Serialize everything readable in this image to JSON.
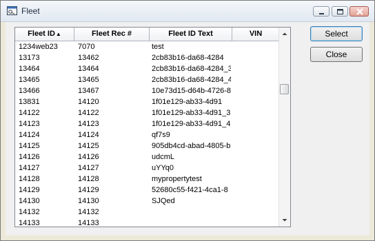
{
  "window": {
    "title": "Fleet"
  },
  "table": {
    "columns": [
      "Fleet ID",
      "Fleet Rec #",
      "Fleet ID Text",
      "VIN"
    ],
    "sort_indicator": "▲",
    "rows": [
      [
        "1234web23",
        "7070",
        "test",
        ""
      ],
      [
        "13173",
        "13462",
        "2cb83b16-da68-4284",
        ""
      ],
      [
        "13464",
        "13464",
        "2cb83b16-da68-4284_3",
        ""
      ],
      [
        "13465",
        "13465",
        "2cb83b16-da68-4284_4",
        ""
      ],
      [
        "13466",
        "13467",
        "10e73d15-d64b-4726-8",
        ""
      ],
      [
        "13831",
        "14120",
        "1f01e129-ab33-4d91",
        ""
      ],
      [
        "14122",
        "14122",
        "1f01e129-ab33-4d91_3",
        ""
      ],
      [
        "14123",
        "14123",
        "1f01e129-ab33-4d91_4",
        ""
      ],
      [
        "14124",
        "14124",
        "qf7s9",
        ""
      ],
      [
        "14125",
        "14125",
        "905db4cd-abad-4805-b",
        ""
      ],
      [
        "14126",
        "14126",
        "udcmL",
        ""
      ],
      [
        "14127",
        "14127",
        "uYYq0",
        ""
      ],
      [
        "14128",
        "14128",
        "mypropertytest",
        ""
      ],
      [
        "14129",
        "14129",
        "52680c55-f421-4ca1-8",
        ""
      ],
      [
        "14130",
        "14130",
        "SJQed",
        ""
      ],
      [
        "14132",
        "14132",
        "",
        ""
      ],
      [
        "14133",
        "14133",
        "",
        ""
      ]
    ]
  },
  "buttons": {
    "select": "Select",
    "close": "Close"
  },
  "icons": {
    "app": "app-window-icon",
    "minimize": "minimize-icon",
    "maximize": "maximize-icon",
    "close": "close-icon",
    "scroll_up": "scroll-up-arrow-icon",
    "scroll_down": "scroll-down-arrow-icon",
    "sort": "sort-ascending-icon"
  },
  "colors": {
    "accent": "#3c7fb1",
    "close_button": "#e3a397"
  }
}
